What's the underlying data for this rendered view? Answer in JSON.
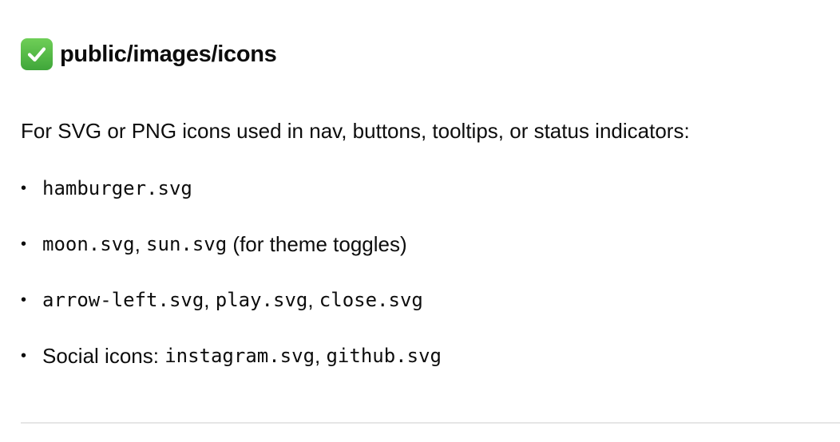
{
  "heading": {
    "icon": "check-mark-button-icon",
    "icon_color": "#4fba45",
    "text": "public/images/icons"
  },
  "intro": "For SVG or PNG icons used in nav, buttons, tooltips, or status indicators:",
  "list": [
    {
      "bullet": "•",
      "parts": [
        {
          "text": "hamburger.svg",
          "code": true
        }
      ]
    },
    {
      "bullet": "•",
      "parts": [
        {
          "text": "moon.svg",
          "code": true
        },
        {
          "text": ", ",
          "code": false
        },
        {
          "text": "sun.svg",
          "code": true
        },
        {
          "text": " (for theme toggles)",
          "code": false
        }
      ]
    },
    {
      "bullet": "•",
      "parts": [
        {
          "text": "arrow-left.svg",
          "code": true
        },
        {
          "text": ", ",
          "code": false
        },
        {
          "text": "play.svg",
          "code": true
        },
        {
          "text": ", ",
          "code": false
        },
        {
          "text": "close.svg",
          "code": true
        }
      ]
    },
    {
      "bullet": "•",
      "parts": [
        {
          "text": "Social icons: ",
          "code": false
        },
        {
          "text": "instagram.svg",
          "code": true
        },
        {
          "text": ", ",
          "code": false
        },
        {
          "text": "github.svg",
          "code": true
        }
      ]
    }
  ]
}
